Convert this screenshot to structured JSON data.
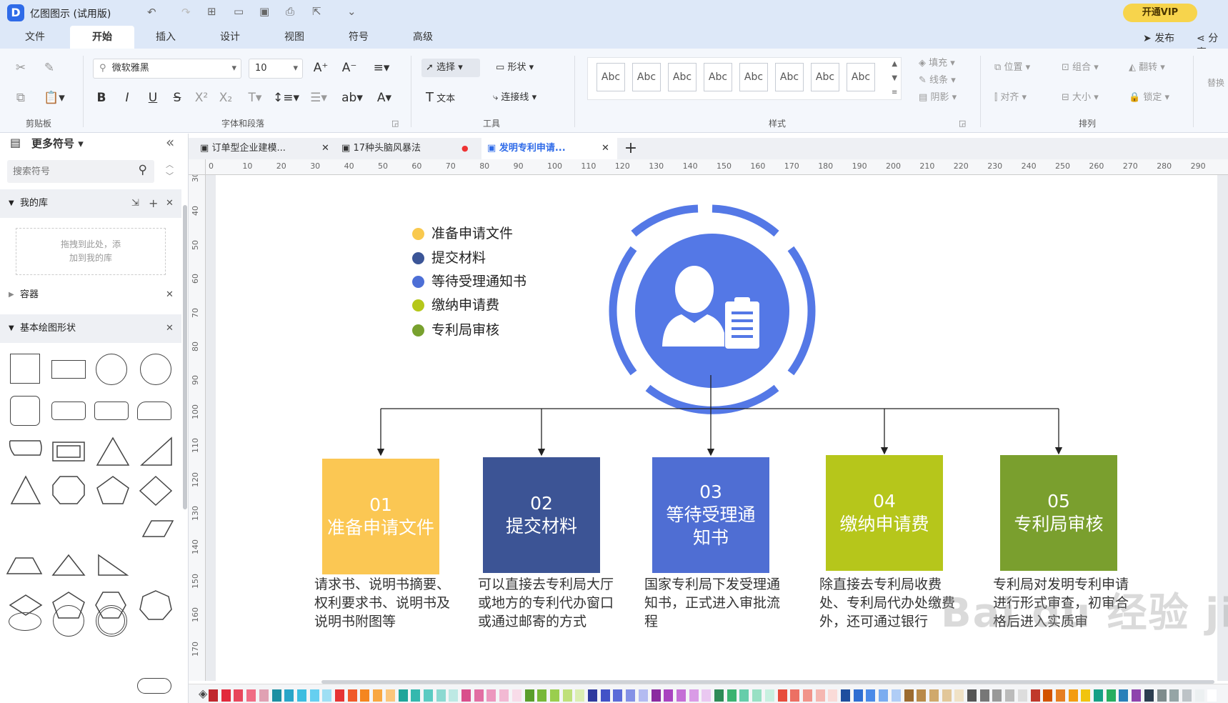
{
  "app": {
    "title": "亿图图示 (试用版)",
    "vip": "开通VIP",
    "publish": "发布",
    "share": "分享"
  },
  "menu": [
    "文件",
    "开始",
    "插入",
    "设计",
    "视图",
    "符号",
    "高级"
  ],
  "ribbon": {
    "groups": {
      "clipboard": "剪贴板",
      "font": "字体和段落",
      "tools": "工具",
      "style": "样式",
      "arrange": "排列"
    },
    "font_name": "微软雅黑",
    "font_size": "10",
    "tools": {
      "select": "选择",
      "shape": "形状",
      "text": "文本",
      "connector": "连接线"
    },
    "abc": [
      "Abc",
      "Abc",
      "Abc",
      "Abc",
      "Abc",
      "Abc",
      "Abc",
      "Abc"
    ],
    "fill": "填充",
    "line": "线条",
    "shadow": "阴影",
    "position": "位置",
    "group": "组合",
    "flip": "翻转",
    "align": "对齐",
    "size": "大小",
    "lock": "锁定",
    "replace": "替换"
  },
  "sidebar": {
    "title": "更多符号",
    "search_placeholder": "搜索符号",
    "my_library": "我的库",
    "drop_hint_1": "拖拽到此处，添",
    "drop_hint_2": "加到我的库",
    "container": "容器",
    "basic_shapes": "基本绘图形状"
  },
  "tabs": [
    {
      "label": "订单型企业建模..."
    },
    {
      "label": "17种头脑风暴法"
    },
    {
      "label": "发明专利申请..."
    }
  ],
  "ruler": {
    "h": [
      "0",
      "10",
      "20",
      "30",
      "40",
      "50",
      "60",
      "70",
      "80",
      "90",
      "100",
      "110",
      "120",
      "130",
      "140",
      "150",
      "160",
      "170",
      "180",
      "190",
      "200",
      "210",
      "220",
      "230",
      "240",
      "250",
      "260",
      "270",
      "280",
      "290"
    ],
    "v": [
      "30",
      "40",
      "50",
      "60",
      "70",
      "80",
      "90",
      "100",
      "110",
      "120",
      "130",
      "140",
      "150",
      "160",
      "170"
    ]
  },
  "diagram": {
    "legend": [
      {
        "label": "准备申请文件",
        "color": "#f9c94e"
      },
      {
        "label": "提交材料",
        "color": "#3b5597"
      },
      {
        "label": "等待受理通知书",
        "color": "#4d6fd6"
      },
      {
        "label": "缴纳申请费",
        "color": "#b5c71a"
      },
      {
        "label": "专利局审核",
        "color": "#78a12e"
      }
    ],
    "steps": [
      {
        "num": "01",
        "title": "准备申请文件",
        "color": "#fbc753",
        "desc": "请求书、说明书摘要、权利要求书、说明书及说明书附图等"
      },
      {
        "num": "02",
        "title": "提交材料",
        "color": "#3c5495",
        "desc": "可以直接去专利局大厅或地方的专利代办窗口或通过邮寄的方式"
      },
      {
        "num": "03",
        "title": "等待受理通知书",
        "color": "#4f6ed3",
        "desc": "国家专利局下发受理通知书，正式进入审批流程"
      },
      {
        "num": "04",
        "title": "缴纳申请费",
        "color": "#b6c61b",
        "desc": "除直接去专利局收费处、专利局代办处缴费外，还可通过银行"
      },
      {
        "num": "05",
        "title": "专利局审核",
        "color": "#7a9f2e",
        "desc": "专利局对发明专利申请进行形式审查，初审合格后进入实质审"
      }
    ],
    "accent": "#5478e6"
  },
  "watermark": "Bai du 经验 jingyan.baidu.com"
}
